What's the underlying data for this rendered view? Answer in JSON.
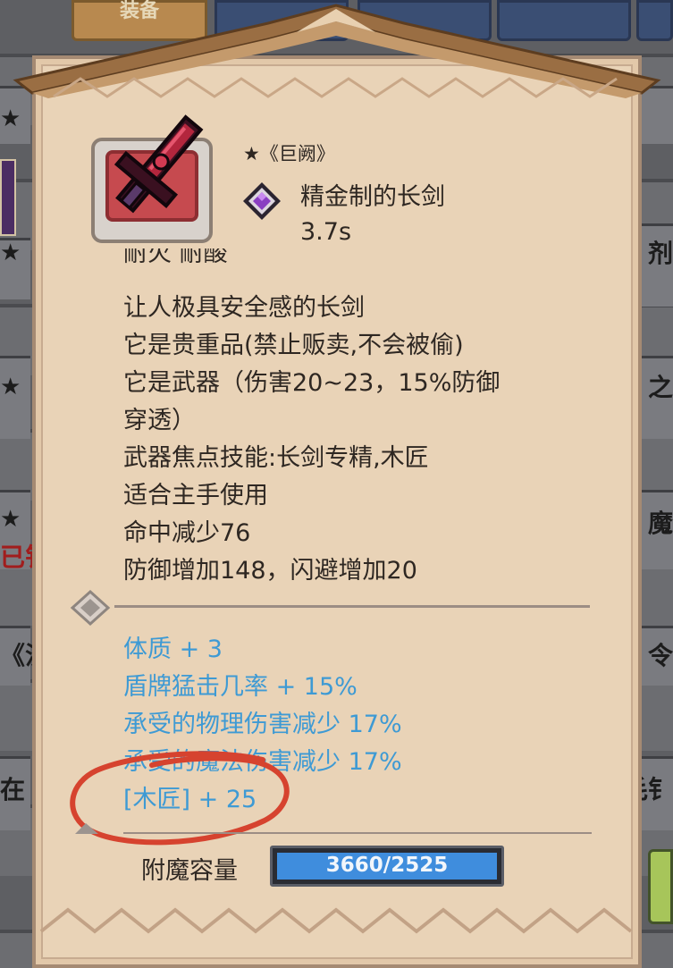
{
  "background": {
    "tabs": [
      {
        "label": "装备",
        "active": true
      },
      {
        "label": "",
        "active": false
      },
      {
        "label": "",
        "active": false
      },
      {
        "label": "",
        "active": false
      }
    ],
    "left_fragments": [
      "★",
      "★",
      "★",
      "★",
      "已钅",
      "《沈",
      "在"
    ],
    "right_fragments": [
      "剂",
      "之",
      "魔",
      "令",
      "毛钅"
    ]
  },
  "item": {
    "star_name": "★《巨阙》",
    "title": "精金制的长剑",
    "attack_time": "3.7s",
    "icon": "sword-icon",
    "quality_icon": "purple-gem-icon"
  },
  "description": {
    "partial_line": "耐火 耐酸",
    "lines": [
      "让人极具安全感的长剑",
      "它是贵重品(禁止贩卖,不会被偷)",
      "它是武器（伤害20~23，15%防御",
      "穿透）",
      "武器焦点技能:长剑专精,木匠",
      "适合主手使用",
      "命中减少76",
      "防御增加148，闪避增加20"
    ]
  },
  "enchantments": [
    "体质 + 3",
    "盾牌猛击几率 + 15%",
    "承受的物理伤害减少 17%",
    "承受的魔法伤害减少 17%",
    "[木匠] + 25"
  ],
  "enchant_capacity": {
    "label": "附魔容量",
    "value": "3660/2525"
  },
  "colors": {
    "panel": "#e9d3b7",
    "text": "#2e2722",
    "enchant_text": "#3e9ad4",
    "bar_fill": "#3f8ddd",
    "annotation_red": "#d6432f"
  }
}
